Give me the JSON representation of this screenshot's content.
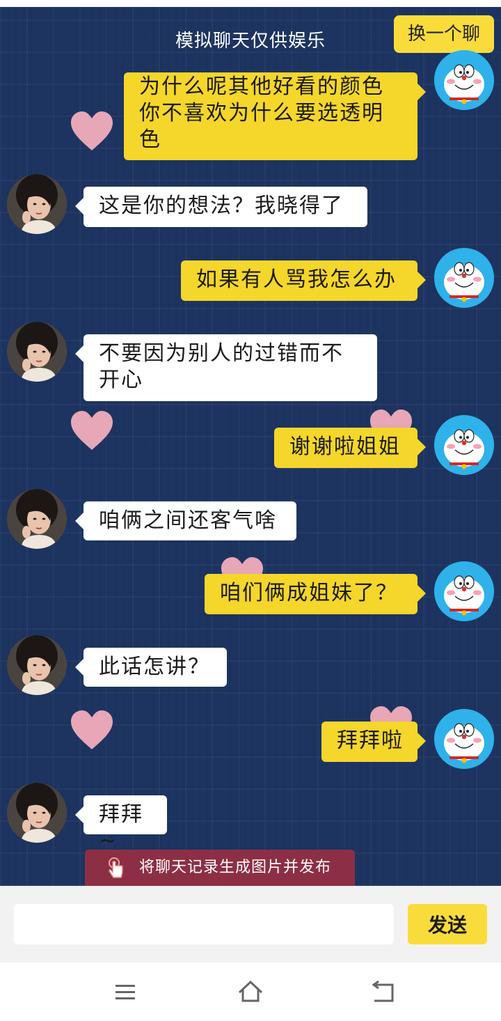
{
  "header": {
    "title": "模拟聊天仅供娱乐",
    "switch_label": "换一个聊"
  },
  "messages": [
    {
      "side": "right",
      "text_lines": [
        "为什么呢其他好看的颜色",
        "你不喜欢为什么要选透明",
        "色"
      ]
    },
    {
      "side": "left",
      "text_lines": [
        "这是你的想法？我晓得了"
      ]
    },
    {
      "side": "right",
      "text_lines": [
        "如果有人骂我怎么办"
      ]
    },
    {
      "side": "left",
      "text_lines": [
        "不要因为别人的过错而不",
        "开心"
      ]
    },
    {
      "side": "right",
      "text_lines": [
        "谢谢啦姐姐"
      ]
    },
    {
      "side": "left",
      "text_lines": [
        "咱俩之间还客气啥"
      ]
    },
    {
      "side": "right",
      "text_lines": [
        "咱们俩成姐妹了？"
      ]
    },
    {
      "side": "left",
      "text_lines": [
        "此话怎讲？"
      ]
    },
    {
      "side": "right",
      "text_lines": [
        "拜拜啦"
      ]
    },
    {
      "side": "left",
      "text_lines": [
        "拜拜~"
      ]
    }
  ],
  "publish_banner": "将聊天记录生成图片并发布",
  "input": {
    "value": "",
    "placeholder": ""
  },
  "send_label": "发送",
  "colors": {
    "background": "#1d3461",
    "right_bubble": "#f5d62a",
    "left_bubble": "#ffffff",
    "accent_button": "#f9dc3b",
    "banner": "#8c2f45",
    "heart": "#e7a7b6",
    "me_avatar": "#2fb1ea"
  },
  "icons": {
    "me_avatar": "doraemon-avatar-icon",
    "her_avatar": "woman-portrait-avatar",
    "banner": "tap-hand-icon",
    "nav": [
      "menu-icon",
      "home-icon",
      "back-icon"
    ]
  }
}
